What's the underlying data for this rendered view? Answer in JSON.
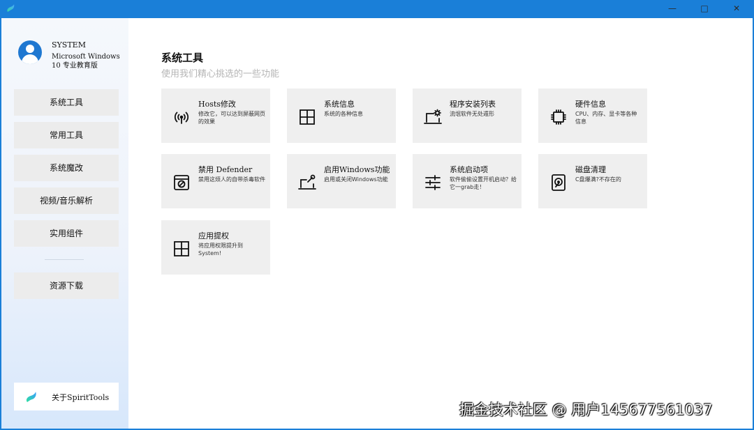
{
  "window": {
    "min_label": "—",
    "max_label": "□",
    "close_label": "✕",
    "accent_color": "#1a7fd8"
  },
  "sidebar": {
    "user": {
      "name": "SYSTEM",
      "os": "Microsoft Windows 10 专业教育版",
      "avatar_icon": "user-avatar-icon"
    },
    "items": [
      {
        "label": "系统工具"
      },
      {
        "label": "常用工具"
      },
      {
        "label": "系统魔改"
      },
      {
        "label": "视频/音乐解析"
      },
      {
        "label": "实用组件"
      },
      {
        "label": "资源下载"
      }
    ],
    "about": {
      "label": "关于SpiritTools",
      "icon": "spirittools-logo"
    }
  },
  "main": {
    "title": "系统工具",
    "subtitle": "使用我们精心挑选的一些功能",
    "cards": [
      {
        "title": "Hosts修改",
        "desc": "修改它，可以达到屏蔽网页的效果",
        "icon": "wifi-antenna-icon"
      },
      {
        "title": "系统信息",
        "desc": "系统的各种信息",
        "icon": "windows-logo-icon"
      },
      {
        "title": "程序安装列表",
        "desc": "流氓软件无处遁形",
        "icon": "laptop-gear-icon"
      },
      {
        "title": "硬件信息",
        "desc": "CPU、内存、显卡等各种信息",
        "icon": "chip-icon"
      },
      {
        "title": "禁用 Defender",
        "desc": "禁用这烦人的自带杀毒软件",
        "icon": "blocked-window-icon"
      },
      {
        "title": "启用Windows功能",
        "desc": "启用或关闭Windows功能",
        "icon": "laptop-wrench-icon"
      },
      {
        "title": "系统启动项",
        "desc": "软件偷偷设置开机启动？给它一grab走！",
        "icon": "sliders-icon"
      },
      {
        "title": "磁盘清理",
        "desc": "C盘爆满?不存在的",
        "icon": "hard-disk-icon"
      },
      {
        "title": "应用提权",
        "desc": "将应用权限提升到System!",
        "icon": "windows-logo-icon"
      }
    ]
  },
  "watermark": "掘金技术社区 @ 用户1456775610​37"
}
